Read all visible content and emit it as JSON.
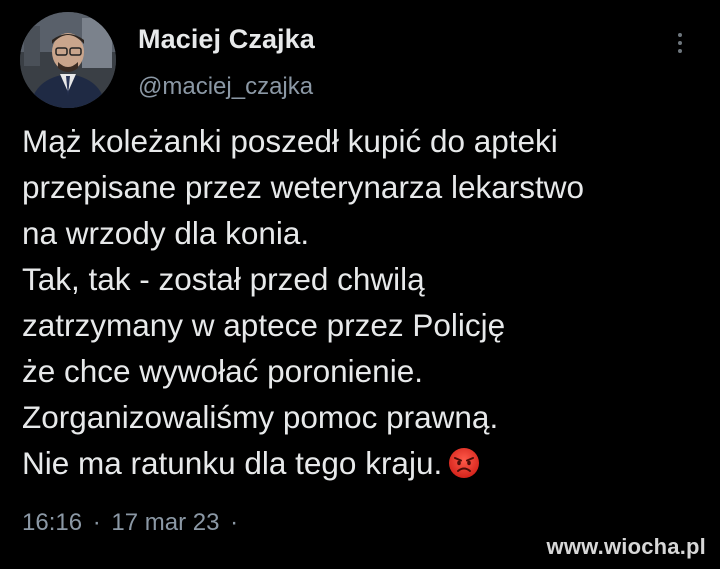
{
  "author": {
    "display_name": "Maciej Czajka",
    "handle": "@maciej_czajka"
  },
  "tweet": {
    "lines": [
      "Mąż koleżanki poszedł kupić do apteki",
      "przepisane przez weterynarza lekarstwo",
      "na wrzody dla konia.",
      "Tak, tak - został przed chwilą",
      "zatrzymany w aptece przez Policję",
      "że chce wywołać poronienie.",
      "Zorganizowaliśmy pomoc prawną.",
      "Nie ma ratunku dla tego kraju."
    ],
    "emoji": "angry-face-icon"
  },
  "meta": {
    "time": "16:16",
    "separator": "·",
    "date": "17 mar 23",
    "trailing_separator": "·"
  },
  "watermark": "www.wiocha.pl",
  "colors": {
    "background": "#000000",
    "primary_text": "#e7e9ea",
    "secondary_text": "#8b98a5"
  }
}
